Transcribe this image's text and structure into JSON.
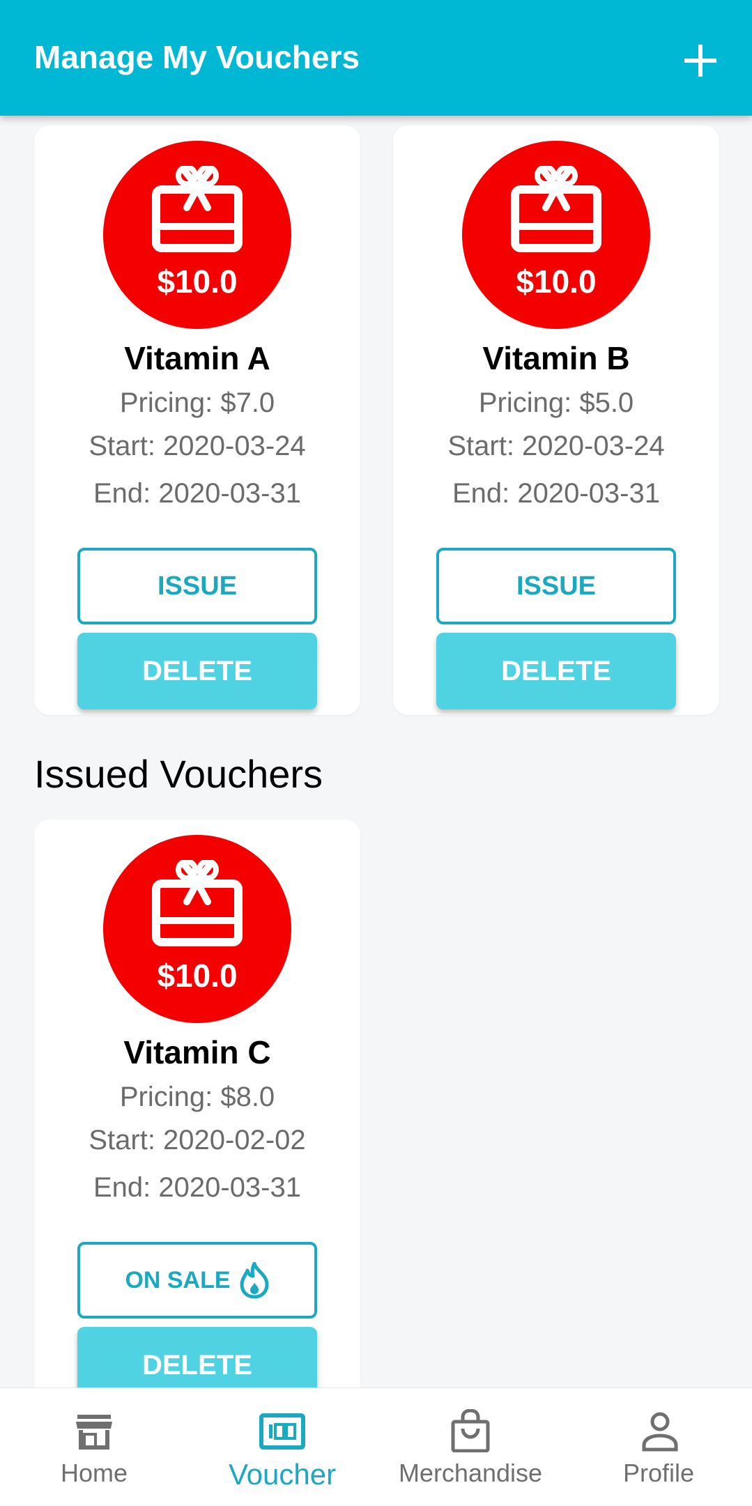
{
  "header": {
    "title": "Manage My Vouchers",
    "add_icon": "plus-icon"
  },
  "colors": {
    "accent": "#00b8d4",
    "badge": "#f40000",
    "button_fill": "#4fd2e2",
    "outline": "#1aa9c0"
  },
  "vouchers": [
    {
      "amount": "$10.0",
      "name": "Vitamin A",
      "pricing": "Pricing: $7.0",
      "start": "Start: 2020-03-24",
      "end": "End: 2020-03-31",
      "primary_action": "ISSUE",
      "delete_action": "DELETE"
    },
    {
      "amount": "$10.0",
      "name": "Vitamin B",
      "pricing": "Pricing: $5.0",
      "start": "Start: 2020-03-24",
      "end": "End: 2020-03-31",
      "primary_action": "ISSUE",
      "delete_action": "DELETE"
    }
  ],
  "issued_section": {
    "title": "Issued Vouchers"
  },
  "issued_vouchers": [
    {
      "amount": "$10.0",
      "name": "Vitamin C",
      "pricing": "Pricing: $8.0",
      "start": "Start: 2020-02-02",
      "end": "End: 2020-03-31",
      "status_action": "ON SALE",
      "status_icon": "fire-icon",
      "delete_action": "DELETE"
    }
  ],
  "bottom_nav": {
    "items": [
      {
        "label": "Home",
        "icon": "store-icon"
      },
      {
        "label": "Voucher",
        "icon": "voucher-icon"
      },
      {
        "label": "Merchandise",
        "icon": "shopping-bag-icon"
      },
      {
        "label": "Profile",
        "icon": "person-icon"
      }
    ],
    "active": "Voucher"
  }
}
